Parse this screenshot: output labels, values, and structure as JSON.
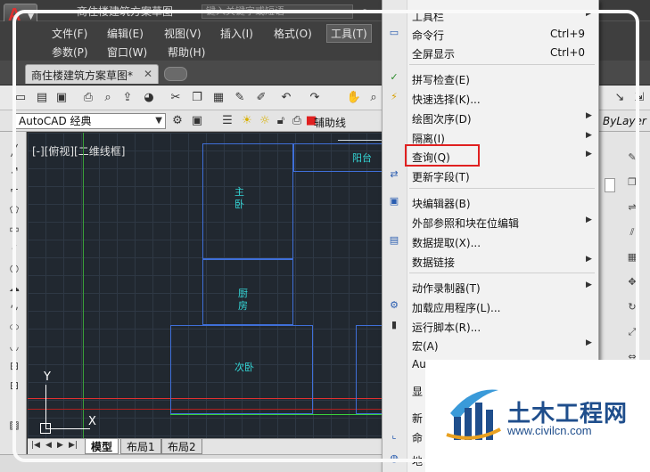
{
  "titlebar": {
    "title": "商住楼建筑方案草图",
    "search_placeholder": "键入关键字或短语"
  },
  "menubar": {
    "row1": [
      "文件(F)",
      "编辑(E)",
      "视图(V)",
      "插入(I)",
      "格式(O)",
      "工具(T)"
    ],
    "row2": [
      "参数(P)",
      "窗口(W)",
      "帮助(H)"
    ],
    "active": "工具(T)"
  },
  "tabs": {
    "document": "商住楼建筑方案草图*",
    "close": "✕"
  },
  "toolbar2": {
    "workspace": "AutoCAD 经典",
    "layer": "辅助线",
    "linetype": "ByLayer"
  },
  "canvas": {
    "view_label": "[-][俯视][二维线框]",
    "rooms": {
      "balcony": "阳台",
      "master_bedroom": "主\n卧",
      "kitchen": "厨\n房",
      "second_bedroom": "次卧"
    },
    "ucs": {
      "y": "Y",
      "x": "X"
    }
  },
  "layout_tabs": [
    "模型",
    "布局1",
    "布局2"
  ],
  "context_menu": {
    "items": [
      {
        "label": "工具栏",
        "shortcut": "",
        "submenu": true
      },
      {
        "label": "命令行",
        "shortcut": "Ctrl+9",
        "submenu": false
      },
      {
        "label": "全屏显示",
        "shortcut": "Ctrl+0",
        "submenu": false
      },
      {
        "label": "拼写检查(E)",
        "shortcut": "",
        "submenu": false
      },
      {
        "label": "快速选择(K)...",
        "shortcut": "",
        "submenu": false
      },
      {
        "label": "绘图次序(D)",
        "shortcut": "",
        "submenu": true
      },
      {
        "label": "隔离(I)",
        "shortcut": "",
        "submenu": true
      },
      {
        "label": "查询(Q)",
        "shortcut": "",
        "submenu": true
      },
      {
        "label": "更新字段(T)",
        "shortcut": "",
        "submenu": false
      },
      {
        "label": "块编辑器(B)",
        "shortcut": "",
        "submenu": false
      },
      {
        "label": "外部参照和块在位编辑",
        "shortcut": "",
        "submenu": true
      },
      {
        "label": "数据提取(X)...",
        "shortcut": "",
        "submenu": false
      },
      {
        "label": "数据链接",
        "shortcut": "",
        "submenu": true
      },
      {
        "label": "动作录制器(T)",
        "shortcut": "",
        "submenu": true
      },
      {
        "label": "加载应用程序(L)...",
        "shortcut": "",
        "submenu": false
      },
      {
        "label": "运行脚本(R)...",
        "shortcut": "",
        "submenu": false
      },
      {
        "label": "宏(A)",
        "shortcut": "",
        "submenu": true
      },
      {
        "label": "Au",
        "shortcut": "",
        "submenu": false
      },
      {
        "label": "显",
        "shortcut": "",
        "submenu": false
      },
      {
        "label": "新",
        "shortcut": "",
        "submenu": false
      },
      {
        "label": "命",
        "shortcut": "",
        "submenu": false
      },
      {
        "label": "地",
        "shortcut": "",
        "submenu": false
      }
    ],
    "highlighted": "查询(Q)",
    "highlight_color": "#e02020"
  },
  "watermark": {
    "name": "土木工程网",
    "url": "www.civilcn.com"
  },
  "colors": {
    "canvas_bg": "#212830",
    "wall": "#3f6fd8",
    "room_text": "#34d8d8",
    "axis_red": "#e03030",
    "axis_green": "#3ad03a"
  }
}
